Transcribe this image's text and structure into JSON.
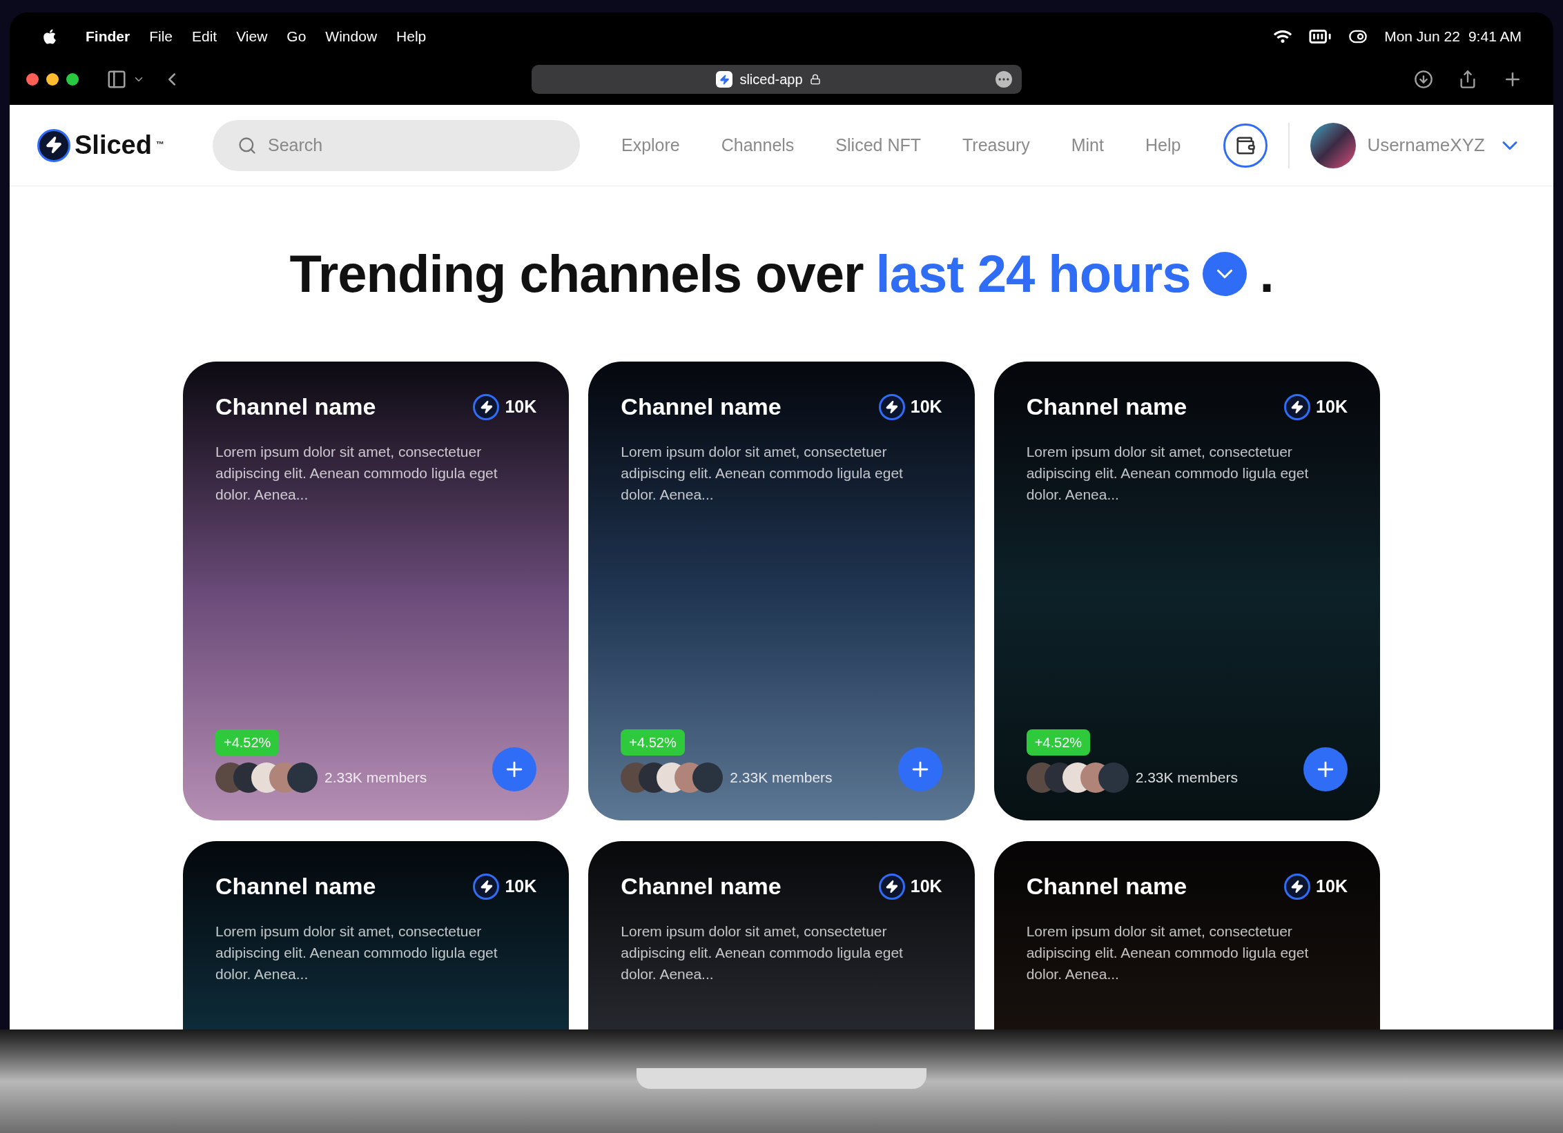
{
  "menu_bar": {
    "app": "Finder",
    "menus": [
      "File",
      "Edit",
      "View",
      "Go",
      "Window",
      "Help"
    ],
    "date": "Mon Jun 22",
    "time": "9:41 AM"
  },
  "browser": {
    "address": "sliced-app"
  },
  "nav": {
    "logo": "Sliced",
    "trademark": "™",
    "search": {
      "placeholder": "Search"
    },
    "links": [
      "Explore",
      "Channels",
      "Sliced NFT",
      "Treasury",
      "Mint",
      "Help"
    ],
    "username": "UsernameXYZ"
  },
  "heading": {
    "text": "Trending channels over",
    "period": "last 24 hours",
    "end": "."
  },
  "channels": [
    {
      "name": "Channel name",
      "count": "10K",
      "description": "Lorem ipsum dolor sit amet, consectetuer adipiscing elit. Aenean commodo ligula eget dolor. Aenea...",
      "change": "+4.52%",
      "members": "2.33K members"
    },
    {
      "name": "Channel name",
      "count": "10K",
      "description": "Lorem ipsum dolor sit amet, consectetuer adipiscing elit. Aenean commodo ligula eget dolor. Aenea...",
      "change": "+4.52%",
      "members": "2.33K members"
    },
    {
      "name": "Channel name",
      "count": "10K",
      "description": "Lorem ipsum dolor sit amet, consectetuer adipiscing elit. Aenean commodo ligula eget dolor. Aenea...",
      "change": "+4.52%",
      "members": "2.33K members"
    },
    {
      "name": "Channel name",
      "count": "10K",
      "description": "Lorem ipsum dolor sit amet, consectetuer adipiscing elit. Aenean commodo ligula eget dolor. Aenea..."
    },
    {
      "name": "Channel name",
      "count": "10K",
      "description": "Lorem ipsum dolor sit amet, consectetuer adipiscing elit. Aenean commodo ligula eget dolor. Aenea..."
    },
    {
      "name": "Channel name",
      "count": "10K",
      "description": "Lorem ipsum dolor sit amet, consectetuer adipiscing elit. Aenean commodo ligula eget dolor. Aenea..."
    }
  ]
}
